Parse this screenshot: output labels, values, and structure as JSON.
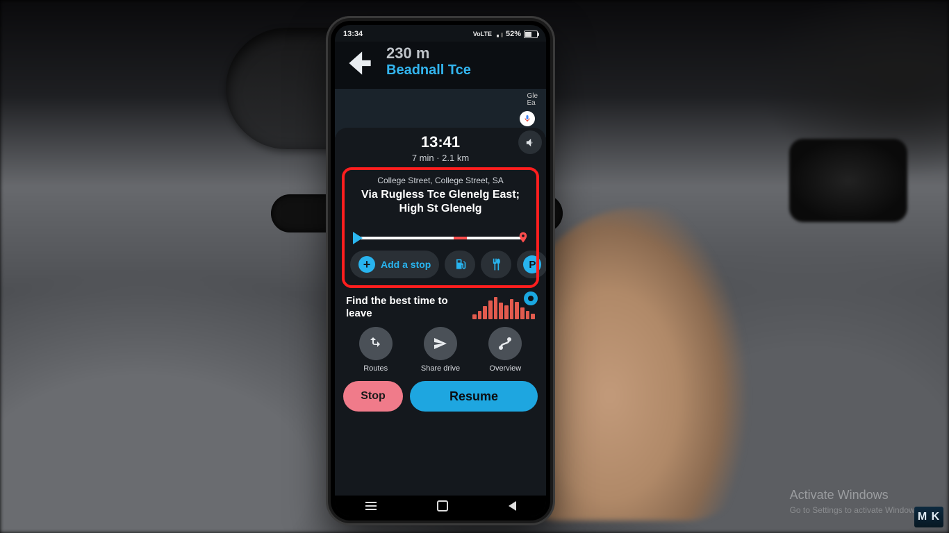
{
  "statusbar": {
    "time": "13:34",
    "battery": "52%"
  },
  "nav": {
    "distance": "230 m",
    "road": "Beadnall Tce"
  },
  "map": {
    "peek_label": "Gle\nEa"
  },
  "eta": {
    "arrival": "13:41",
    "sub": "7 min · 2.1 km"
  },
  "route": {
    "dest_sub": "College Street, College Street, SA",
    "dest_main": "Via Rugless Tce Glenelg East; High St Glenelg",
    "add_stop_label": "Add a stop",
    "parking_letter": "P"
  },
  "leave": {
    "text": "Find the best time to leave"
  },
  "actions": {
    "routes": "Routes",
    "share": "Share drive",
    "overview": "Overview"
  },
  "buttons": {
    "stop": "Stop",
    "resume": "Resume"
  },
  "watermark": {
    "title": "Activate Windows",
    "sub": "Go to Settings to activate Windows."
  },
  "logo": "M K",
  "colors": {
    "accent": "#28b4ef",
    "stop": "#f07b8a",
    "danger": "#ff1e1e"
  }
}
